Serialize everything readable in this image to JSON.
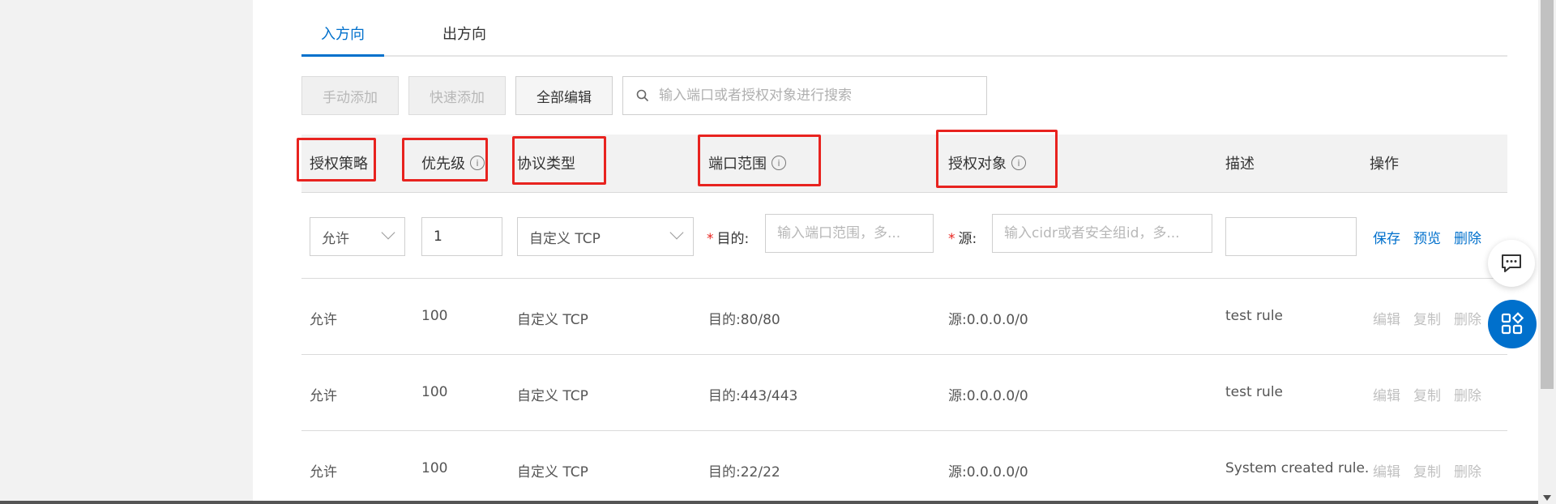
{
  "tabs": [
    {
      "label": "入方向",
      "active": true
    },
    {
      "label": "出方向",
      "active": false
    }
  ],
  "toolbar": {
    "manual_add": "手动添加",
    "quick_add": "快速添加",
    "edit_all": "全部编辑",
    "search_placeholder": "输入端口或者授权对象进行搜索"
  },
  "columns": {
    "policy": "授权策略",
    "priority": "优先级",
    "protocol": "协议类型",
    "port_range": "端口范围",
    "auth_object": "授权对象",
    "description": "描述",
    "actions": "操作"
  },
  "edit_row": {
    "policy": "允许",
    "priority": "1",
    "protocol": "自定义 TCP",
    "dest_label": "目的:",
    "dest_placeholder": "输入端口范围，多...",
    "source_label": "源:",
    "source_placeholder": "输入cidr或者安全组id，多...",
    "description": "",
    "save": "保存",
    "preview": "预览",
    "delete": "删除"
  },
  "rules": [
    {
      "policy": "允许",
      "priority": "100",
      "protocol": "自定义 TCP",
      "port": "目的:80/80",
      "source": "源:0.0.0.0/0",
      "description": "test rule",
      "edit": "编辑",
      "copy": "复制",
      "delete": "删除"
    },
    {
      "policy": "允许",
      "priority": "100",
      "protocol": "自定义 TCP",
      "port": "目的:443/443",
      "source": "源:0.0.0.0/0",
      "description": "test rule",
      "edit": "编辑",
      "copy": "复制",
      "delete": "删除"
    },
    {
      "policy": "允许",
      "priority": "100",
      "protocol": "自定义 TCP",
      "port": "目的:22/22",
      "source": "源:0.0.0.0/0",
      "description": "System created rule.",
      "edit": "编辑",
      "copy": "复制",
      "delete": "删除"
    }
  ],
  "colors": {
    "accent": "#0070cc",
    "highlight_box": "#e8231f",
    "required_star": "#e8231f"
  },
  "icons": {
    "search": "search-icon",
    "info": "info-icon",
    "chevron": "chevron-down-icon",
    "collapse": "chevron-left-icon",
    "chat": "chat-icon",
    "apps": "apps-icon"
  }
}
